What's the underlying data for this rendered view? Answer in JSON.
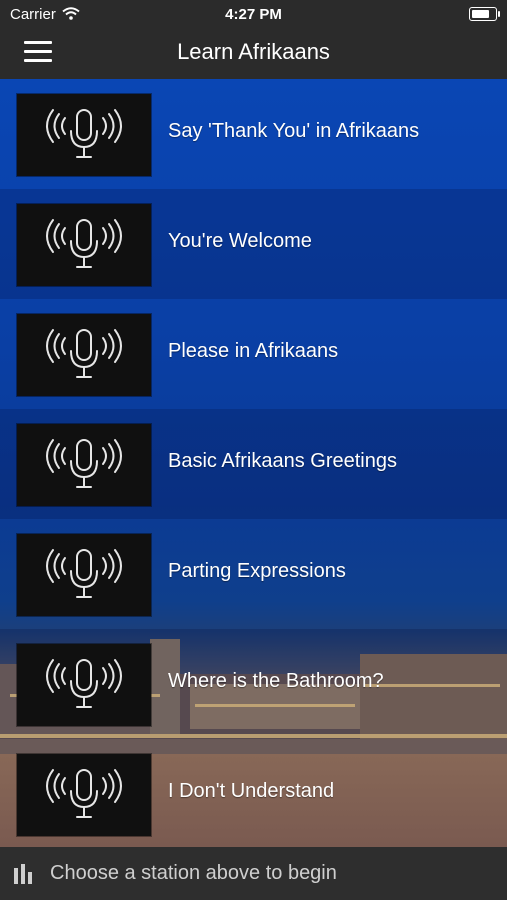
{
  "status_bar": {
    "carrier": "Carrier",
    "time": "4:27 PM"
  },
  "nav": {
    "title": "Learn Afrikaans",
    "menu_icon": "hamburger-menu-icon"
  },
  "stations": [
    {
      "label": "Say 'Thank You' in Afrikaans",
      "icon": "microphone-icon"
    },
    {
      "label": "You're Welcome",
      "icon": "microphone-icon"
    },
    {
      "label": "Please in Afrikaans",
      "icon": "microphone-icon"
    },
    {
      "label": "Basic Afrikaans Greetings",
      "icon": "microphone-icon"
    },
    {
      "label": "Parting Expressions",
      "icon": "microphone-icon"
    },
    {
      "label": "Where is the Bathroom?",
      "icon": "microphone-icon"
    },
    {
      "label": "I Don't Understand",
      "icon": "microphone-icon"
    }
  ],
  "footer": {
    "message": "Choose a station above to begin",
    "icon": "equalizer-icon"
  },
  "colors": {
    "bar": "#2b2b2b",
    "accent_blue": "#0a46b4",
    "thumb": "#101010"
  }
}
